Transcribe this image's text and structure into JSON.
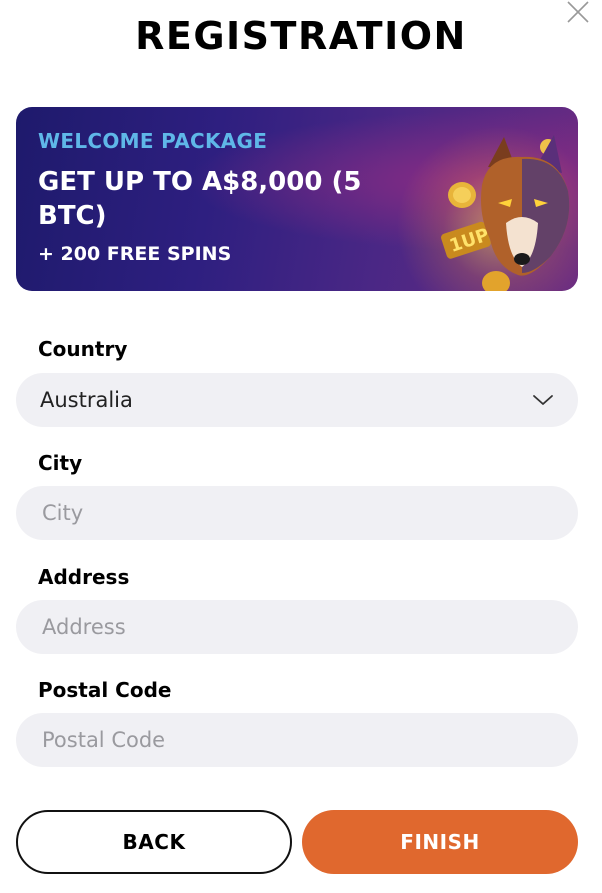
{
  "title": "REGISTRATION",
  "banner": {
    "kicker": "WELCOME PACKAGE",
    "headline": "GET UP TO A$8,000 (5 BTC)",
    "sub": "+ 200 FREE SPINS"
  },
  "form": {
    "country": {
      "label": "Country",
      "value": "Australia"
    },
    "city": {
      "label": "City",
      "placeholder": "City"
    },
    "address": {
      "label": "Address",
      "placeholder": "Address"
    },
    "postal": {
      "label": "Postal Code",
      "placeholder": "Postal Code"
    }
  },
  "buttons": {
    "back": "BACK",
    "finish": "FINISH"
  },
  "colors": {
    "accent": "#e0682e",
    "field_bg": "#f0f0f4",
    "kicker": "#5fb7e8"
  },
  "icons": {
    "close": "close-icon",
    "dropdown": "chevron-down-icon",
    "banner_art": "wolf-mascot-image"
  }
}
